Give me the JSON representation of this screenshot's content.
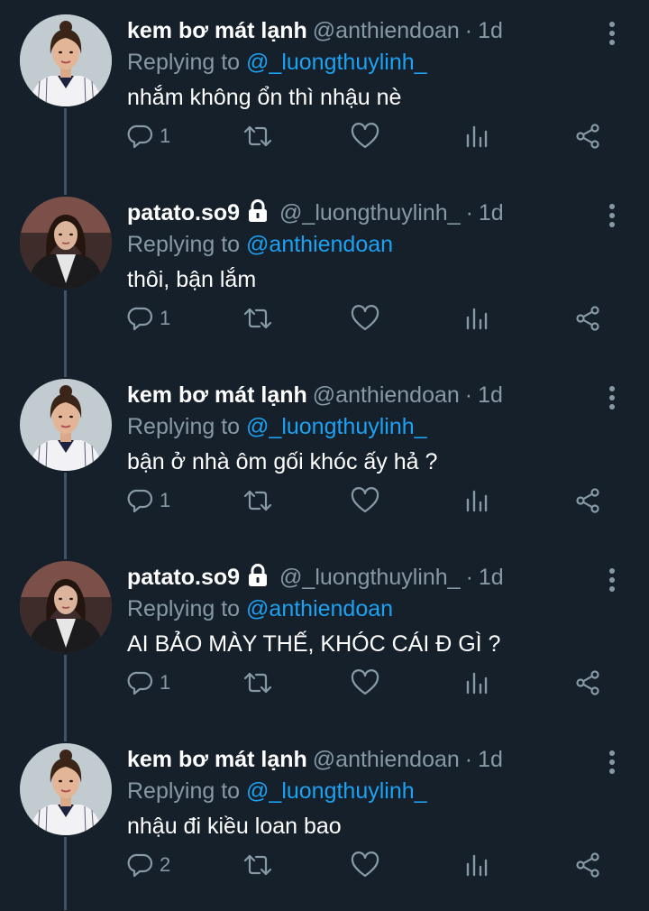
{
  "colors": {
    "background": "#15202b",
    "secondary_text": "#8899a6",
    "mention": "#1da1f2",
    "thread_line": "#3d5466"
  },
  "tweets": [
    {
      "avatar": "avatar-kem",
      "display_name": "kem bơ mát lạnh",
      "locked": false,
      "handle": "@anthiendoan",
      "dot": "·",
      "time": "1d",
      "replying_prefix": "Replying to",
      "replying_handle": "@_luongthuylinh_",
      "text": "nhắm không ổn thì nhậu nè",
      "reply_count": "1"
    },
    {
      "avatar": "avatar-patato",
      "display_name": "patato.so9",
      "locked": true,
      "handle": "@_luongthuylinh_",
      "dot": "·",
      "time": "1d",
      "replying_prefix": "Replying to",
      "replying_handle": "@anthiendoan",
      "text": "thôi, bận lắm",
      "reply_count": "1"
    },
    {
      "avatar": "avatar-kem",
      "display_name": "kem bơ mát lạnh",
      "locked": false,
      "handle": "@anthiendoan",
      "dot": "·",
      "time": "1d",
      "replying_prefix": "Replying to",
      "replying_handle": "@_luongthuylinh_",
      "text": "bận ở nhà ôm gối khóc ấy hả ?",
      "reply_count": "1"
    },
    {
      "avatar": "avatar-patato",
      "display_name": "patato.so9",
      "locked": true,
      "handle": "@_luongthuylinh_",
      "dot": "·",
      "time": "1d",
      "replying_prefix": "Replying to",
      "replying_handle": "@anthiendoan",
      "text": "AI BẢO MÀY THẾ, KHÓC CÁI Đ GÌ ?",
      "reply_count": "1"
    },
    {
      "avatar": "avatar-kem",
      "display_name": "kem bơ mát lạnh",
      "locked": false,
      "handle": "@anthiendoan",
      "dot": "·",
      "time": "1d",
      "replying_prefix": "Replying to",
      "replying_handle": "@_luongthuylinh_",
      "text": "nhậu đi kiều loan bao",
      "reply_count": "2"
    }
  ]
}
